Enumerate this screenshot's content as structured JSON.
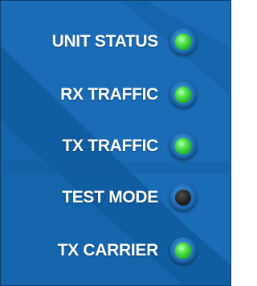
{
  "panel": {
    "background_color": "#1565ad",
    "indicators": [
      {
        "label": "UNIT STATUS",
        "state": "on",
        "led_color": "#39d43a"
      },
      {
        "label": "RX TRAFFIC",
        "state": "on",
        "led_color": "#39d43a"
      },
      {
        "label": "TX TRAFFIC",
        "state": "on",
        "led_color": "#39d43a"
      },
      {
        "label": "TEST MODE",
        "state": "off",
        "led_color": "#1a1a1a"
      },
      {
        "label": "TX CARRIER",
        "state": "on",
        "led_color": "#39d43a"
      }
    ]
  }
}
